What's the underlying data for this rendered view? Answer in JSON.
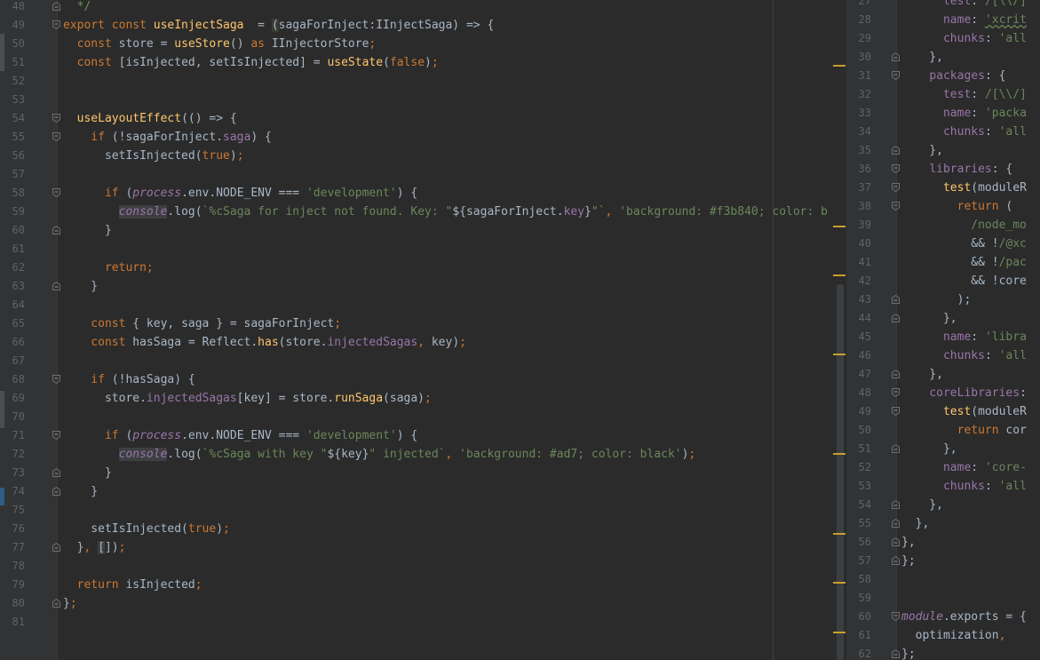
{
  "left_editor": {
    "lines": [
      {
        "n": "48",
        "fold": "end",
        "segs": [
          [
            "cmt",
            "  */"
          ]
        ]
      },
      {
        "n": "49",
        "fold": "start",
        "segs": [
          [
            "kw",
            "export const "
          ],
          [
            "fn",
            "useInjectSaga"
          ],
          [
            "",
            "  = "
          ],
          [
            "hl",
            "("
          ],
          [
            "",
            "sagaForInject:IInjectSaga) => {"
          ]
        ]
      },
      {
        "n": "50",
        "segs": [
          [
            "kw",
            "  const "
          ],
          [
            "",
            "store = "
          ],
          [
            "fn",
            "useStore"
          ],
          [
            "",
            "() "
          ],
          [
            "kw",
            "as "
          ],
          [
            "",
            "IInjectorStore"
          ],
          [
            "kw",
            ";"
          ]
        ]
      },
      {
        "n": "51",
        "segs": [
          [
            "kw",
            "  const "
          ],
          [
            "",
            "[isInjected, setIsInjected] = "
          ],
          [
            "fn",
            "useState"
          ],
          [
            "",
            "("
          ],
          [
            "kw",
            "false"
          ],
          [
            "",
            ")"
          ],
          [
            "kw",
            ";"
          ]
        ]
      },
      {
        "n": "52",
        "segs": []
      },
      {
        "n": "53",
        "segs": []
      },
      {
        "n": "54",
        "fold": "start",
        "segs": [
          [
            "fn",
            "  useLayoutEffect"
          ],
          [
            "",
            "(() => {"
          ]
        ]
      },
      {
        "n": "55",
        "fold": "start",
        "segs": [
          [
            "kw",
            "    if "
          ],
          [
            "",
            "(!sagaForInject."
          ],
          [
            "prop",
            "saga"
          ],
          [
            "",
            ") {"
          ]
        ]
      },
      {
        "n": "56",
        "segs": [
          [
            "",
            "      setIsInjected("
          ],
          [
            "kw",
            "true"
          ],
          [
            "",
            ")"
          ],
          [
            "kw",
            ";"
          ]
        ]
      },
      {
        "n": "57",
        "segs": []
      },
      {
        "n": "58",
        "fold": "start",
        "segs": [
          [
            "kw",
            "      if "
          ],
          [
            "",
            "("
          ],
          [
            "prop ital",
            "process"
          ],
          [
            "",
            ".env."
          ],
          [
            "",
            "NODE_ENV === "
          ],
          [
            "str",
            "'development'"
          ],
          [
            "",
            ") {"
          ]
        ]
      },
      {
        "n": "59",
        "segs": [
          [
            "",
            "        "
          ],
          [
            "prop ital hlb",
            "console"
          ],
          [
            "",
            ".log("
          ],
          [
            "str",
            "`%cSaga for inject not found. Key: \""
          ],
          [
            "",
            "${sagaForInject."
          ],
          [
            "prop",
            "key"
          ],
          [
            "",
            "}"
          ],
          [
            "str",
            "\"`"
          ],
          [
            "kw",
            ", "
          ],
          [
            "str",
            "'background: #f3b840; color: b"
          ]
        ]
      },
      {
        "n": "60",
        "fold": "end",
        "segs": [
          [
            "",
            "      }"
          ]
        ]
      },
      {
        "n": "61",
        "segs": []
      },
      {
        "n": "62",
        "segs": [
          [
            "kw",
            "      return;"
          ]
        ]
      },
      {
        "n": "63",
        "fold": "end",
        "segs": [
          [
            "",
            "    }"
          ]
        ]
      },
      {
        "n": "64",
        "segs": []
      },
      {
        "n": "65",
        "segs": [
          [
            "kw",
            "    const "
          ],
          [
            "",
            "{ key, saga } = sagaForInject"
          ],
          [
            "kw",
            ";"
          ]
        ]
      },
      {
        "n": "66",
        "segs": [
          [
            "kw",
            "    const "
          ],
          [
            "",
            "hasSaga = Reflect."
          ],
          [
            "fn",
            "has"
          ],
          [
            "",
            "(store."
          ],
          [
            "prop",
            "injectedSagas"
          ],
          [
            "kw",
            ", "
          ],
          [
            "",
            "key)"
          ],
          [
            "kw",
            ";"
          ]
        ]
      },
      {
        "n": "67",
        "segs": []
      },
      {
        "n": "68",
        "fold": "start",
        "segs": [
          [
            "kw",
            "    if "
          ],
          [
            "",
            "(!hasSaga) {"
          ]
        ]
      },
      {
        "n": "69",
        "segs": [
          [
            "",
            "      store."
          ],
          [
            "prop",
            "injectedSagas"
          ],
          [
            "",
            "[key] = store."
          ],
          [
            "fn",
            "runSaga"
          ],
          [
            "",
            "(saga)"
          ],
          [
            "kw",
            ";"
          ]
        ]
      },
      {
        "n": "70",
        "segs": []
      },
      {
        "n": "71",
        "fold": "start",
        "segs": [
          [
            "kw",
            "      if "
          ],
          [
            "",
            "("
          ],
          [
            "prop ital",
            "process"
          ],
          [
            "",
            ".env."
          ],
          [
            "",
            "NODE_ENV === "
          ],
          [
            "str",
            "'development'"
          ],
          [
            "",
            ") {"
          ]
        ]
      },
      {
        "n": "72",
        "segs": [
          [
            "",
            "        "
          ],
          [
            "prop ital hlb",
            "console"
          ],
          [
            "",
            ".log("
          ],
          [
            "str",
            "`%cSaga with key \""
          ],
          [
            "",
            "${key}"
          ],
          [
            "str",
            "\" injected`"
          ],
          [
            "kw",
            ", "
          ],
          [
            "str",
            "'background: #ad7; color: black'"
          ],
          [
            "",
            ")"
          ],
          [
            "kw",
            ";"
          ]
        ]
      },
      {
        "n": "73",
        "fold": "end",
        "segs": [
          [
            "",
            "      }"
          ]
        ]
      },
      {
        "n": "74",
        "fold": "end",
        "segs": [
          [
            "",
            "    }"
          ]
        ]
      },
      {
        "n": "75",
        "segs": []
      },
      {
        "n": "76",
        "segs": [
          [
            "",
            "    setIsInjected("
          ],
          [
            "kw",
            "true"
          ],
          [
            "",
            ")"
          ],
          [
            "kw",
            ";"
          ]
        ]
      },
      {
        "n": "77",
        "fold": "end",
        "segs": [
          [
            "",
            "  }"
          ],
          [
            "kw",
            ", "
          ],
          [
            "hlb",
            "["
          ],
          [
            "",
            "])"
          ],
          [
            "kw",
            ";"
          ]
        ]
      },
      {
        "n": "78",
        "segs": []
      },
      {
        "n": "79",
        "segs": [
          [
            "kw",
            "  return "
          ],
          [
            "",
            "isInjected"
          ],
          [
            "kw",
            ";"
          ]
        ]
      },
      {
        "n": "80",
        "fold": "end",
        "segs": [
          [
            "",
            "}"
          ],
          [
            "kw",
            ";"
          ]
        ]
      },
      {
        "n": "81",
        "segs": []
      }
    ]
  },
  "right_editor": {
    "lines": [
      {
        "n": "27",
        "segs": [
          [
            "",
            "      "
          ],
          [
            "prop",
            "test"
          ],
          [
            "",
            ": "
          ],
          [
            "str",
            "/[\\\\/]"
          ]
        ]
      },
      {
        "n": "28",
        "segs": [
          [
            "",
            "      "
          ],
          [
            "prop",
            "name"
          ],
          [
            "",
            ": "
          ],
          [
            "str ul",
            "'xcrit"
          ]
        ]
      },
      {
        "n": "29",
        "segs": [
          [
            "",
            "      "
          ],
          [
            "prop",
            "chunks"
          ],
          [
            "",
            ": "
          ],
          [
            "str",
            "'all"
          ]
        ]
      },
      {
        "n": "30",
        "fold": "end",
        "segs": [
          [
            "",
            "    },"
          ]
        ]
      },
      {
        "n": "31",
        "fold": "start",
        "segs": [
          [
            "",
            "    "
          ],
          [
            "prop",
            "packages"
          ],
          [
            "",
            ": {"
          ]
        ]
      },
      {
        "n": "32",
        "segs": [
          [
            "",
            "      "
          ],
          [
            "prop",
            "test"
          ],
          [
            "",
            ": "
          ],
          [
            "str",
            "/[\\\\/]"
          ]
        ]
      },
      {
        "n": "33",
        "segs": [
          [
            "",
            "      "
          ],
          [
            "prop",
            "name"
          ],
          [
            "",
            ": "
          ],
          [
            "str",
            "'packa"
          ]
        ]
      },
      {
        "n": "34",
        "segs": [
          [
            "",
            "      "
          ],
          [
            "prop",
            "chunks"
          ],
          [
            "",
            ": "
          ],
          [
            "str",
            "'all"
          ]
        ]
      },
      {
        "n": "35",
        "fold": "end",
        "segs": [
          [
            "",
            "    },"
          ]
        ]
      },
      {
        "n": "36",
        "fold": "start",
        "segs": [
          [
            "",
            "    "
          ],
          [
            "prop",
            "libraries"
          ],
          [
            "",
            ": {"
          ]
        ]
      },
      {
        "n": "37",
        "fold": "start",
        "segs": [
          [
            "",
            "      "
          ],
          [
            "fn",
            "test"
          ],
          [
            "",
            "(moduleR"
          ]
        ]
      },
      {
        "n": "38",
        "fold": "start",
        "segs": [
          [
            "kw",
            "        return "
          ],
          [
            "",
            "("
          ]
        ]
      },
      {
        "n": "39",
        "segs": [
          [
            "str",
            "          /node_mo"
          ]
        ]
      },
      {
        "n": "40",
        "segs": [
          [
            "",
            "          && !"
          ],
          [
            "str",
            "/@xc"
          ]
        ]
      },
      {
        "n": "41",
        "segs": [
          [
            "",
            "          && !"
          ],
          [
            "str",
            "/pac"
          ]
        ]
      },
      {
        "n": "42",
        "segs": [
          [
            "",
            "          && !core"
          ]
        ]
      },
      {
        "n": "43",
        "fold": "end",
        "segs": [
          [
            "",
            "        );"
          ]
        ]
      },
      {
        "n": "44",
        "fold": "end",
        "segs": [
          [
            "",
            "      },"
          ]
        ]
      },
      {
        "n": "45",
        "segs": [
          [
            "",
            "      "
          ],
          [
            "prop",
            "name"
          ],
          [
            "",
            ": "
          ],
          [
            "str",
            "'libra"
          ]
        ]
      },
      {
        "n": "46",
        "segs": [
          [
            "",
            "      "
          ],
          [
            "prop",
            "chunks"
          ],
          [
            "",
            ": "
          ],
          [
            "str",
            "'all"
          ]
        ]
      },
      {
        "n": "47",
        "fold": "end",
        "segs": [
          [
            "",
            "    },"
          ]
        ]
      },
      {
        "n": "48",
        "fold": "start",
        "segs": [
          [
            "",
            "    "
          ],
          [
            "prop",
            "coreLibraries"
          ],
          [
            "",
            ":"
          ]
        ]
      },
      {
        "n": "49",
        "fold": "start",
        "segs": [
          [
            "",
            "      "
          ],
          [
            "fn",
            "test"
          ],
          [
            "",
            "(moduleR"
          ]
        ]
      },
      {
        "n": "50",
        "segs": [
          [
            "kw",
            "        return "
          ],
          [
            "",
            "cor"
          ]
        ]
      },
      {
        "n": "51",
        "fold": "end",
        "segs": [
          [
            "",
            "      },"
          ]
        ]
      },
      {
        "n": "52",
        "segs": [
          [
            "",
            "      "
          ],
          [
            "prop",
            "name"
          ],
          [
            "",
            ": "
          ],
          [
            "str",
            "'core-"
          ]
        ]
      },
      {
        "n": "53",
        "segs": [
          [
            "",
            "      "
          ],
          [
            "prop",
            "chunks"
          ],
          [
            "",
            ": "
          ],
          [
            "str",
            "'all"
          ]
        ]
      },
      {
        "n": "54",
        "fold": "end",
        "segs": [
          [
            "",
            "    },"
          ]
        ]
      },
      {
        "n": "55",
        "fold": "end",
        "segs": [
          [
            "",
            "  },"
          ]
        ]
      },
      {
        "n": "56",
        "fold": "end",
        "segs": [
          [
            "",
            "},"
          ]
        ]
      },
      {
        "n": "57",
        "fold": "end",
        "segs": [
          [
            "",
            "};"
          ]
        ]
      },
      {
        "n": "58",
        "segs": []
      },
      {
        "n": "59",
        "segs": []
      },
      {
        "n": "60",
        "fold": "start",
        "segs": [
          [
            "prop ital",
            "module"
          ],
          [
            "",
            ".exports = {"
          ]
        ]
      },
      {
        "n": "61",
        "segs": [
          [
            "",
            "  optimization"
          ],
          [
            "kw",
            ","
          ]
        ]
      },
      {
        "n": "62",
        "fold": "end",
        "segs": [
          [
            "",
            "};"
          ]
        ]
      }
    ]
  },
  "colors": {
    "background": "#2b2b2b",
    "gutter": "#313335",
    "keyword": "#cc7832",
    "function": "#ffc66d",
    "string": "#6a8759",
    "property": "#9876aa",
    "warning_marker": "#c8a02a"
  },
  "icons": [
    "fold-start-icon",
    "fold-end-icon"
  ]
}
